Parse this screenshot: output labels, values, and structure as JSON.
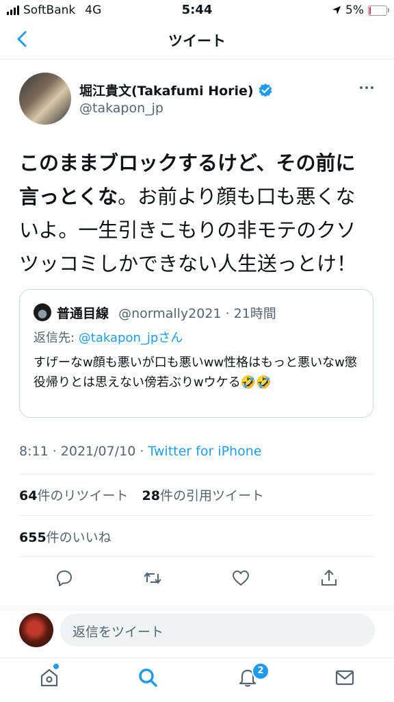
{
  "status_bar": {
    "carrier": "SoftBank",
    "network": "4G",
    "time": "5:44",
    "battery": "5%",
    "battery_level": 0.05
  },
  "nav": {
    "title": "ツイート"
  },
  "author": {
    "name": "堀江貴文(Takafumi Horie)",
    "handle": "@takapon_jp",
    "verified": true
  },
  "tweet": {
    "bold_text": "このままブロックするけど、その前に言っとくな",
    "text": "。お前より顔も口も悪くないよ。一生引きこもりの非モテのクソツッコミしかできない人生送っとけ！"
  },
  "quote": {
    "name": "普通目線",
    "handle_time": "@normally2021 · 21時間",
    "reply_prefix": "返信先: ",
    "reply_handle": "@takapon_jpさん",
    "text": "すげーなw顔も悪いが口も悪いww性格はもっと悪いなw懲役帰りとは思えない傍若ぶりwウケる🤣🤣"
  },
  "meta": {
    "time_date": "8:11 · 2021/07/10 · ",
    "source": "Twitter for iPhone"
  },
  "stats": {
    "retweets": "64",
    "retweets_label": "件のリツイート",
    "quotes": "28",
    "quotes_label": "件の引用ツイート",
    "likes": "655",
    "likes_label": "件のいいね"
  },
  "reply": {
    "placeholder": "返信をツイート"
  },
  "tabbar": {
    "notifications_badge": "2"
  },
  "colors": {
    "accent": "#1d9bf0",
    "text": "#0f1419",
    "secondary": "#536471"
  }
}
